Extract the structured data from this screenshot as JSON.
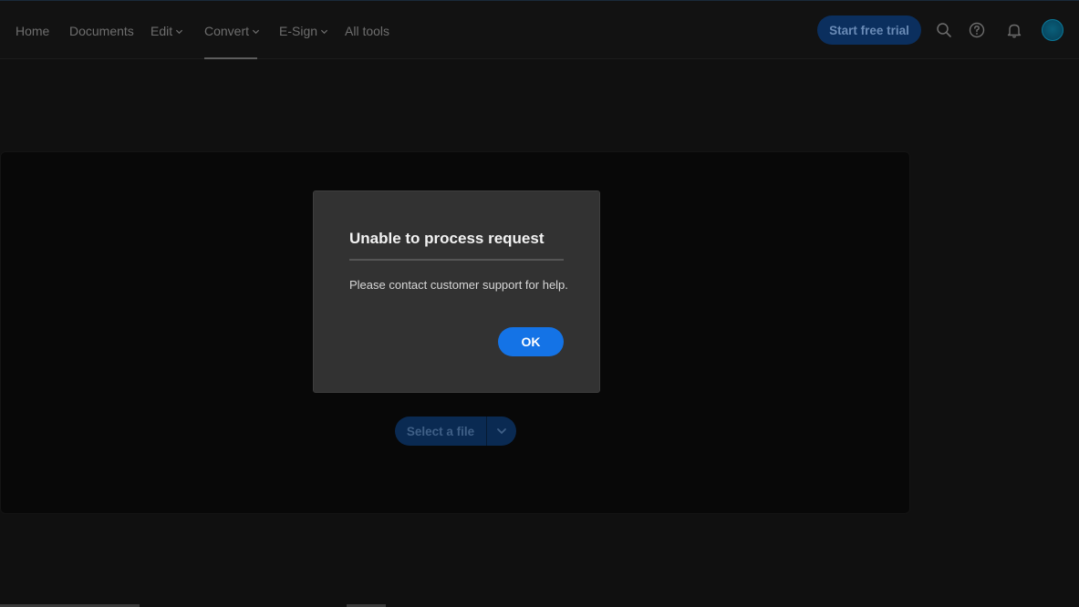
{
  "nav": {
    "items": [
      {
        "label": "Home",
        "has_menu": false
      },
      {
        "label": "Documents",
        "has_menu": false
      },
      {
        "label": "Edit",
        "has_menu": true
      },
      {
        "label": "Convert",
        "has_menu": true,
        "active": true
      },
      {
        "label": "E-Sign",
        "has_menu": true
      },
      {
        "label": "All tools",
        "has_menu": false
      }
    ],
    "trial_label": "Start free trial",
    "icons": [
      "search-icon",
      "help-icon",
      "bell-icon",
      "avatar"
    ]
  },
  "main": {
    "select_file_label": "Select a file"
  },
  "dialog": {
    "title": "Unable to process request",
    "message": "Please contact customer support for help.",
    "ok_label": "OK"
  },
  "colors": {
    "accent": "#1473e6",
    "background": "#101010",
    "dialog": "#323232"
  }
}
